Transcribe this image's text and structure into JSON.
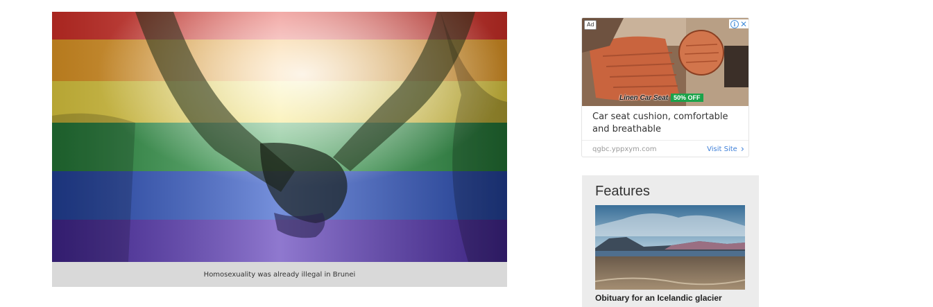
{
  "main_figure": {
    "caption": "Homosexuality was already illegal in Brunei"
  },
  "ad": {
    "badge": "Ad",
    "info_icon": "info-icon",
    "close_icon": "close-icon",
    "product_name": "Linen Car Seat",
    "discount": "50% OFF",
    "headline": "Car seat cushion, comfortable and breathable",
    "domain": "qgbc.yppxym.com",
    "visit_label": "Visit Site",
    "chevron": "›"
  },
  "features": {
    "title": "Features",
    "items": [
      {
        "headline": "Obituary for an Icelandic glacier"
      }
    ]
  },
  "colors": {
    "caption_bg": "#d9d9d9",
    "features_bg": "#ececec",
    "link_blue": "#3d7fd8",
    "discount_green": "#1aa34a"
  }
}
